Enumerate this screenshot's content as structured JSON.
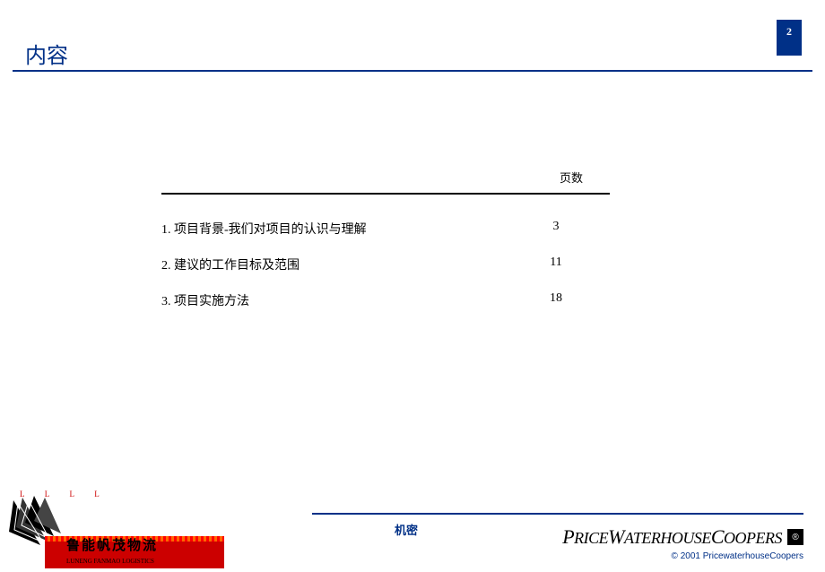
{
  "page_number": "2",
  "title": "内容",
  "toc": {
    "header": "页数",
    "rows": [
      {
        "label": "1. 项目背景-我们对项目的认识与理解",
        "page": "3"
      },
      {
        "label": "2. 建议的工作目标及范围",
        "page": "11"
      },
      {
        "label": "3. 项目实施方法",
        "page": "18"
      }
    ]
  },
  "footer": {
    "confidential": "机密",
    "left_logo_text": "鲁能帆茂物流",
    "left_logo_subtext": "LUNENG FANMAO LOGISTICS",
    "right_logo_text_parts": {
      "p1": "P",
      "p2": "RICE",
      "p3": "W",
      "p4": "ATERHOUSE",
      "p5": "C",
      "p6": "OOPERS"
    },
    "right_logo_mark": "®",
    "copyright": "© 2001 PricewaterhouseCoopers"
  }
}
